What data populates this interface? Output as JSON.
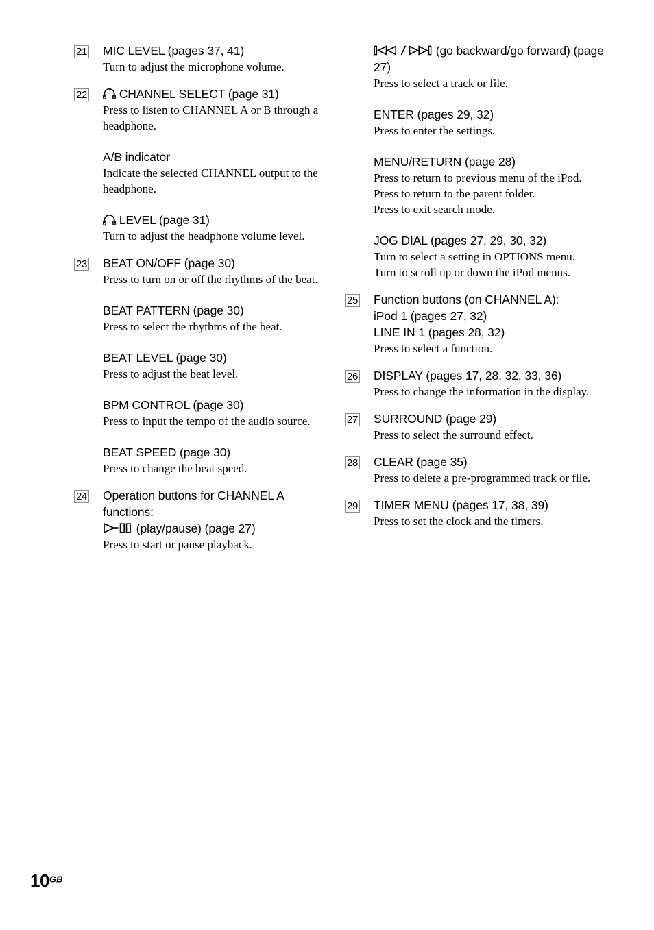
{
  "page": {
    "number": "10",
    "region_suffix": "GB"
  },
  "icons": {
    "headphone": "headphone-icon",
    "play_pause": "play-pause-icon",
    "skip_backward_forward": "skip-backward-forward-icon"
  },
  "left_column": {
    "entries": [
      {
        "badge": "21",
        "heading": "MIC LEVEL (pages 37, 41)",
        "descriptions": [
          "Turn to adjust the microphone volume."
        ]
      },
      {
        "badge": "22",
        "heading_icon": "headphone",
        "heading": "CHANNEL SELECT (page 31)",
        "descriptions": [
          "Press to listen to CHANNEL A or B through a headphone."
        ],
        "subentries": [
          {
            "heading": "A/B indicator",
            "descriptions": [
              "Indicate the selected CHANNEL output to the headphone."
            ]
          },
          {
            "heading_icon": "headphone",
            "heading": "LEVEL (page 31)",
            "descriptions": [
              "Turn to adjust the headphone volume level."
            ]
          }
        ]
      },
      {
        "badge": "23",
        "heading": "BEAT ON/OFF (page 30)",
        "descriptions": [
          "Press to turn on or off the rhythms of the beat."
        ],
        "subentries": [
          {
            "heading": "BEAT PATTERN (page 30)",
            "descriptions": [
              "Press to select the rhythms of the beat."
            ]
          },
          {
            "heading": "BEAT LEVEL (page 30)",
            "descriptions": [
              "Press to adjust the beat level."
            ]
          },
          {
            "heading": "BPM CONTROL (page 30)",
            "descriptions": [
              "Press to input the tempo of the audio source."
            ]
          },
          {
            "heading": "BEAT SPEED (page 30)",
            "descriptions": [
              "Press to change the beat speed."
            ]
          }
        ]
      },
      {
        "badge": "24",
        "heading": "Operation buttons for CHANNEL A functions:",
        "heading_extra_icon": "play_pause",
        "heading_extra": "(play/pause) (page 27)",
        "descriptions": [
          "Press to start or pause playback."
        ]
      }
    ]
  },
  "right_column": {
    "entries": [
      {
        "badge": "",
        "heading_icon": "skip_backward_forward",
        "heading": "(go backward/go forward) (page 27)",
        "descriptions": [
          "Press to select a track or file."
        ]
      },
      {
        "badge": "",
        "heading": "ENTER (pages 29, 32)",
        "descriptions": [
          "Press to enter the settings."
        ]
      },
      {
        "badge": "",
        "heading": "MENU/RETURN (page 28)",
        "descriptions": [
          "Press to return to previous menu of the iPod.",
          "Press to return to the parent folder.",
          "Press to exit search mode."
        ]
      },
      {
        "badge": "",
        "heading": "JOG DIAL (pages 27, 29, 30, 32)",
        "descriptions": [
          "Turn to select a setting in OPTIONS menu.",
          "Turn to scroll up or down the iPod menus."
        ]
      },
      {
        "badge": "25",
        "heading": "Function buttons (on CHANNEL A):",
        "sub_headings": [
          "iPod 1 (pages 27, 32)",
          "LINE IN 1 (pages 28, 32)"
        ],
        "descriptions": [
          "Press to select a function."
        ]
      },
      {
        "badge": "26",
        "heading": "DISPLAY (pages 17, 28, 32, 33, 36)",
        "descriptions": [
          "Press to change the information in the display."
        ]
      },
      {
        "badge": "27",
        "heading": "SURROUND (page 29)",
        "descriptions": [
          "Press to select the surround effect."
        ]
      },
      {
        "badge": "28",
        "heading": "CLEAR (page 35)",
        "descriptions": [
          "Press to delete a pre-programmed track or file."
        ]
      },
      {
        "badge": "29",
        "heading": "TIMER MENU (pages 17, 38, 39)",
        "descriptions": [
          "Press to set the clock and the timers."
        ]
      }
    ]
  }
}
